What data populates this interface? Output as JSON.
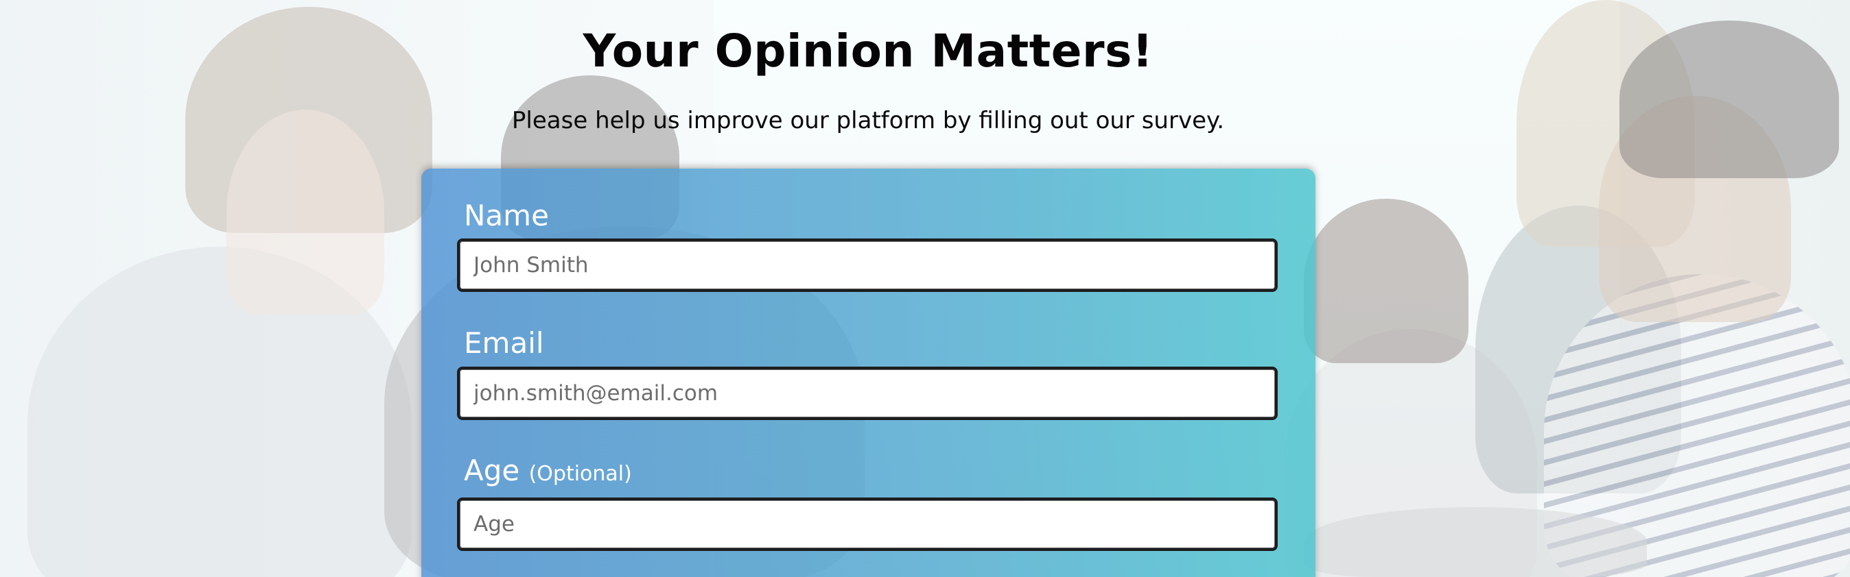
{
  "page": {
    "title": "Your Opinion Matters!",
    "subtitle": "Please help us improve our platform by filling out our survey."
  },
  "form": {
    "name": {
      "label": "Name",
      "placeholder": "John Smith",
      "value": ""
    },
    "email": {
      "label": "Email",
      "placeholder": "john.smith@email.com",
      "value": ""
    },
    "age": {
      "label": "Age",
      "optional_note": "(Optional)",
      "placeholder": "Age",
      "value": ""
    }
  },
  "colors": {
    "card_gradient_start": "#4e92d4",
    "card_gradient_end": "#4cc4ce",
    "label_text": "#ffffff",
    "heading_text": "#050505",
    "field_border": "#1d1d1f"
  },
  "background": {
    "icon": "office-team-photo"
  }
}
